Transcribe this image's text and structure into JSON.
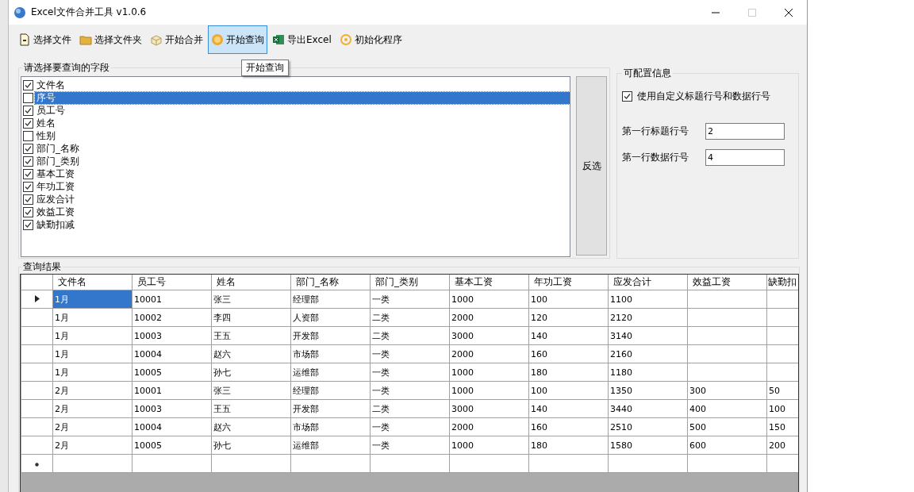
{
  "window": {
    "title": "Excel文件合并工具 v1.0.6"
  },
  "toolbar": [
    {
      "label": "选择文件",
      "selected": false
    },
    {
      "label": "选择文件夹",
      "selected": false
    },
    {
      "label": "开始合并",
      "selected": false
    },
    {
      "label": "开始查询",
      "selected": true
    },
    {
      "label": "导出Excel",
      "selected": false
    },
    {
      "label": "初始化程序",
      "selected": false
    }
  ],
  "tooltip": "开始查询",
  "fields_group": {
    "title": "请选择要查询的字段",
    "invert_button": "反选",
    "items": [
      {
        "label": "文件名",
        "checked": true,
        "selected": false
      },
      {
        "label": "序号",
        "checked": false,
        "selected": true
      },
      {
        "label": "员工号",
        "checked": true,
        "selected": false
      },
      {
        "label": "姓名",
        "checked": true,
        "selected": false
      },
      {
        "label": "性别",
        "checked": false,
        "selected": false
      },
      {
        "label": "部门_名称",
        "checked": true,
        "selected": false
      },
      {
        "label": "部门_类别",
        "checked": true,
        "selected": false
      },
      {
        "label": "基本工资",
        "checked": true,
        "selected": false
      },
      {
        "label": "年功工资",
        "checked": true,
        "selected": false
      },
      {
        "label": "应发合计",
        "checked": true,
        "selected": false
      },
      {
        "label": "效益工资",
        "checked": true,
        "selected": false
      },
      {
        "label": "缺勤扣减",
        "checked": true,
        "selected": false
      }
    ]
  },
  "config_group": {
    "title": "可配置信息",
    "custom_rows": {
      "label": "使用自定义标题行号和数据行号",
      "checked": true
    },
    "fields": [
      {
        "label": "第一行标题行号",
        "value": "2"
      },
      {
        "label": "第一行数据行号",
        "value": "4"
      }
    ]
  },
  "results": {
    "title": "查询结果",
    "columns": [
      "文件名",
      "员工号",
      "姓名",
      "部门_名称",
      "部门_类别",
      "基本工资",
      "年功工资",
      "应发合计",
      "效益工资",
      "缺勤扣"
    ],
    "rows": [
      {
        "selected": true,
        "cells": [
          "1月",
          "10001",
          "张三",
          "经理部",
          "一类",
          "1000",
          "100",
          "1100",
          null,
          null
        ]
      },
      {
        "selected": false,
        "cells": [
          "1月",
          "10002",
          "李四",
          "人资部",
          "二类",
          "2000",
          "120",
          "2120",
          null,
          null
        ]
      },
      {
        "selected": false,
        "cells": [
          "1月",
          "10003",
          "王五",
          "开发部",
          "二类",
          "3000",
          "140",
          "3140",
          null,
          null
        ]
      },
      {
        "selected": false,
        "cells": [
          "1月",
          "10004",
          "赵六",
          "市场部",
          "一类",
          "2000",
          "160",
          "2160",
          null,
          null
        ]
      },
      {
        "selected": false,
        "cells": [
          "1月",
          "10005",
          "孙七",
          "运维部",
          "一类",
          "1000",
          "180",
          "1180",
          null,
          null
        ]
      },
      {
        "selected": false,
        "cells": [
          "2月",
          "10001",
          "张三",
          "经理部",
          "一类",
          "1000",
          "100",
          "1350",
          "300",
          "50"
        ]
      },
      {
        "selected": false,
        "cells": [
          "2月",
          "10003",
          "王五",
          "开发部",
          "二类",
          "3000",
          "140",
          "3440",
          "400",
          "100"
        ]
      },
      {
        "selected": false,
        "cells": [
          "2月",
          "10004",
          "赵六",
          "市场部",
          "一类",
          "2000",
          "160",
          "2510",
          "500",
          "150"
        ]
      },
      {
        "selected": false,
        "cells": [
          "2月",
          "10005",
          "孙七",
          "运维部",
          "一类",
          "1000",
          "180",
          "1580",
          "600",
          "200"
        ]
      }
    ],
    "new_row": true
  }
}
